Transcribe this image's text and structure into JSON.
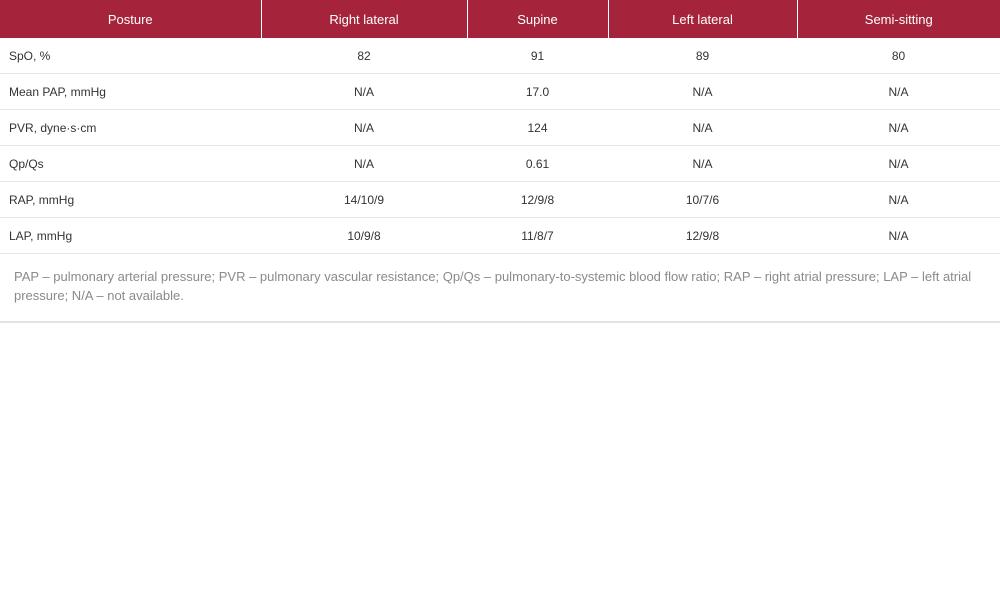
{
  "table": {
    "columns": [
      "Posture",
      "Right lateral",
      "Supine",
      "Left lateral",
      "Semi-sitting"
    ],
    "rows": [
      [
        "SpO, %",
        "82",
        "91",
        "89",
        "80"
      ],
      [
        "Mean PAP, mmHg",
        "N/A",
        "17.0",
        "N/A",
        "N/A"
      ],
      [
        "PVR, dyne·s·cm",
        "N/A",
        "124",
        "N/A",
        "N/A"
      ],
      [
        "Qp/Qs",
        "N/A",
        "0.61",
        "N/A",
        "N/A"
      ],
      [
        "RAP, mmHg",
        "14/10/9",
        "12/9/8",
        "10/7/6",
        "N/A"
      ],
      [
        "LAP, mmHg",
        "10/9/8",
        "11/8/7",
        "12/9/8",
        "N/A"
      ]
    ]
  },
  "footnote": "PAP – pulmonary arterial pressure; PVR – pulmonary vascular resistance; Qp/Qs – pulmonary-to-systemic blood flow ratio; RAP – right atrial pressure; LAP – left atrial pressure; N/A – not available.",
  "colors": {
    "header_bg": "#a5243b",
    "header_text": "#ffffff",
    "footnote_text": "#8a8a8a"
  }
}
